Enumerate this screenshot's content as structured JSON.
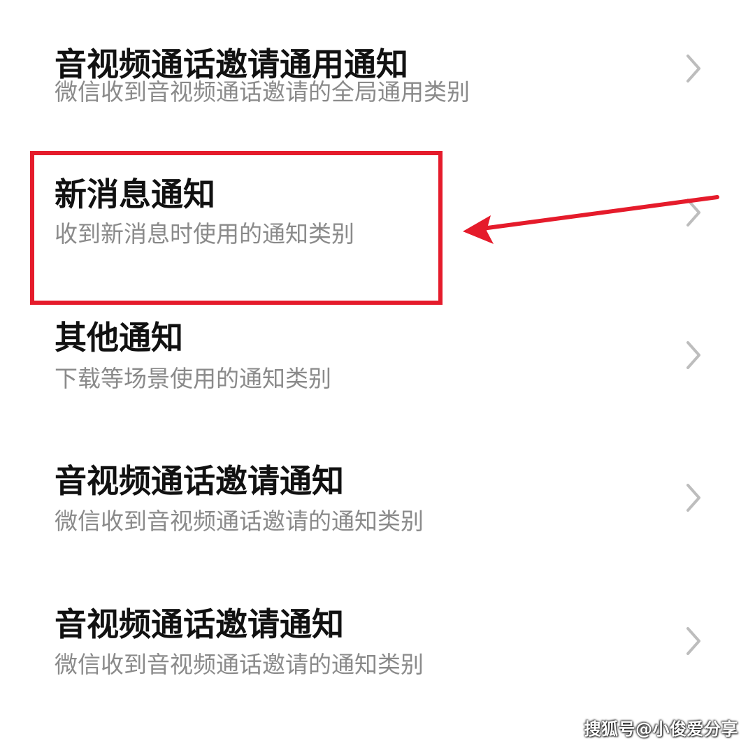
{
  "notification_categories": [
    {
      "title": "音视频通话邀请通用通知",
      "subtitle": "微信收到音视频通话邀请的全局通用类别",
      "chevron_icon": "chevron-right-icon"
    },
    {
      "title": "新消息通知",
      "subtitle": "收到新消息时使用的通知类别",
      "chevron_icon": "chevron-right-icon"
    },
    {
      "title": "其他通知",
      "subtitle": "下载等场景使用的通知类别",
      "chevron_icon": "chevron-right-icon"
    },
    {
      "title": "音视频通话邀请通知",
      "subtitle": "微信收到音视频通话邀请的通知类别",
      "chevron_icon": "chevron-right-icon"
    },
    {
      "title": "音视频通话邀请通知",
      "subtitle": "微信收到音视频通话邀请的通知类别",
      "chevron_icon": "chevron-right-icon"
    }
  ],
  "annotation": {
    "highlight_color": "#e51b2b",
    "arrow_color": "#e51b2b",
    "highlighted_item": "新消息通知"
  },
  "watermark": {
    "text": "搜狐号@小俊爱分享"
  },
  "colors": {
    "title_text": "#111111",
    "subtitle_text": "#8a8a8a",
    "chevron": "#bdbdbd",
    "background": "#ffffff"
  }
}
